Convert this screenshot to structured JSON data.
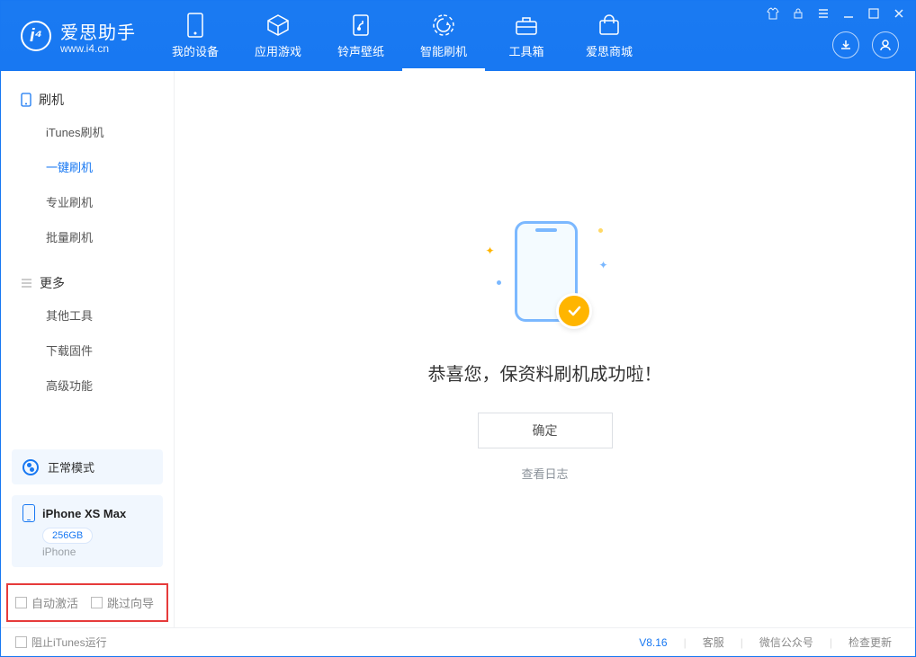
{
  "brand": {
    "name": "爱思助手",
    "url": "www.i4.cn"
  },
  "nav": {
    "items": [
      {
        "label": "我的设备",
        "icon": "device-icon"
      },
      {
        "label": "应用游戏",
        "icon": "apps-icon"
      },
      {
        "label": "铃声壁纸",
        "icon": "ringtone-icon"
      },
      {
        "label": "智能刷机",
        "icon": "flash-icon"
      },
      {
        "label": "工具箱",
        "icon": "toolbox-icon"
      },
      {
        "label": "爱思商城",
        "icon": "store-icon"
      }
    ],
    "activeIndex": 3
  },
  "sidebar": {
    "section1": {
      "title": "刷机",
      "items": [
        "iTunes刷机",
        "一键刷机",
        "专业刷机",
        "批量刷机"
      ],
      "activeIndex": 1
    },
    "section2": {
      "title": "更多",
      "items": [
        "其他工具",
        "下载固件",
        "高级功能"
      ]
    },
    "mode": {
      "label": "正常模式"
    },
    "device": {
      "name": "iPhone XS Max",
      "capacity": "256GB",
      "type": "iPhone"
    },
    "bottomOptions": {
      "opt1": "自动激活",
      "opt2": "跳过向导"
    }
  },
  "main": {
    "successText": "恭喜您，保资料刷机成功啦！",
    "okButton": "确定",
    "logLink": "查看日志"
  },
  "footer": {
    "preventItunes": "阻止iTunes运行",
    "version": "V8.16",
    "links": [
      "客服",
      "微信公众号",
      "检查更新"
    ]
  }
}
